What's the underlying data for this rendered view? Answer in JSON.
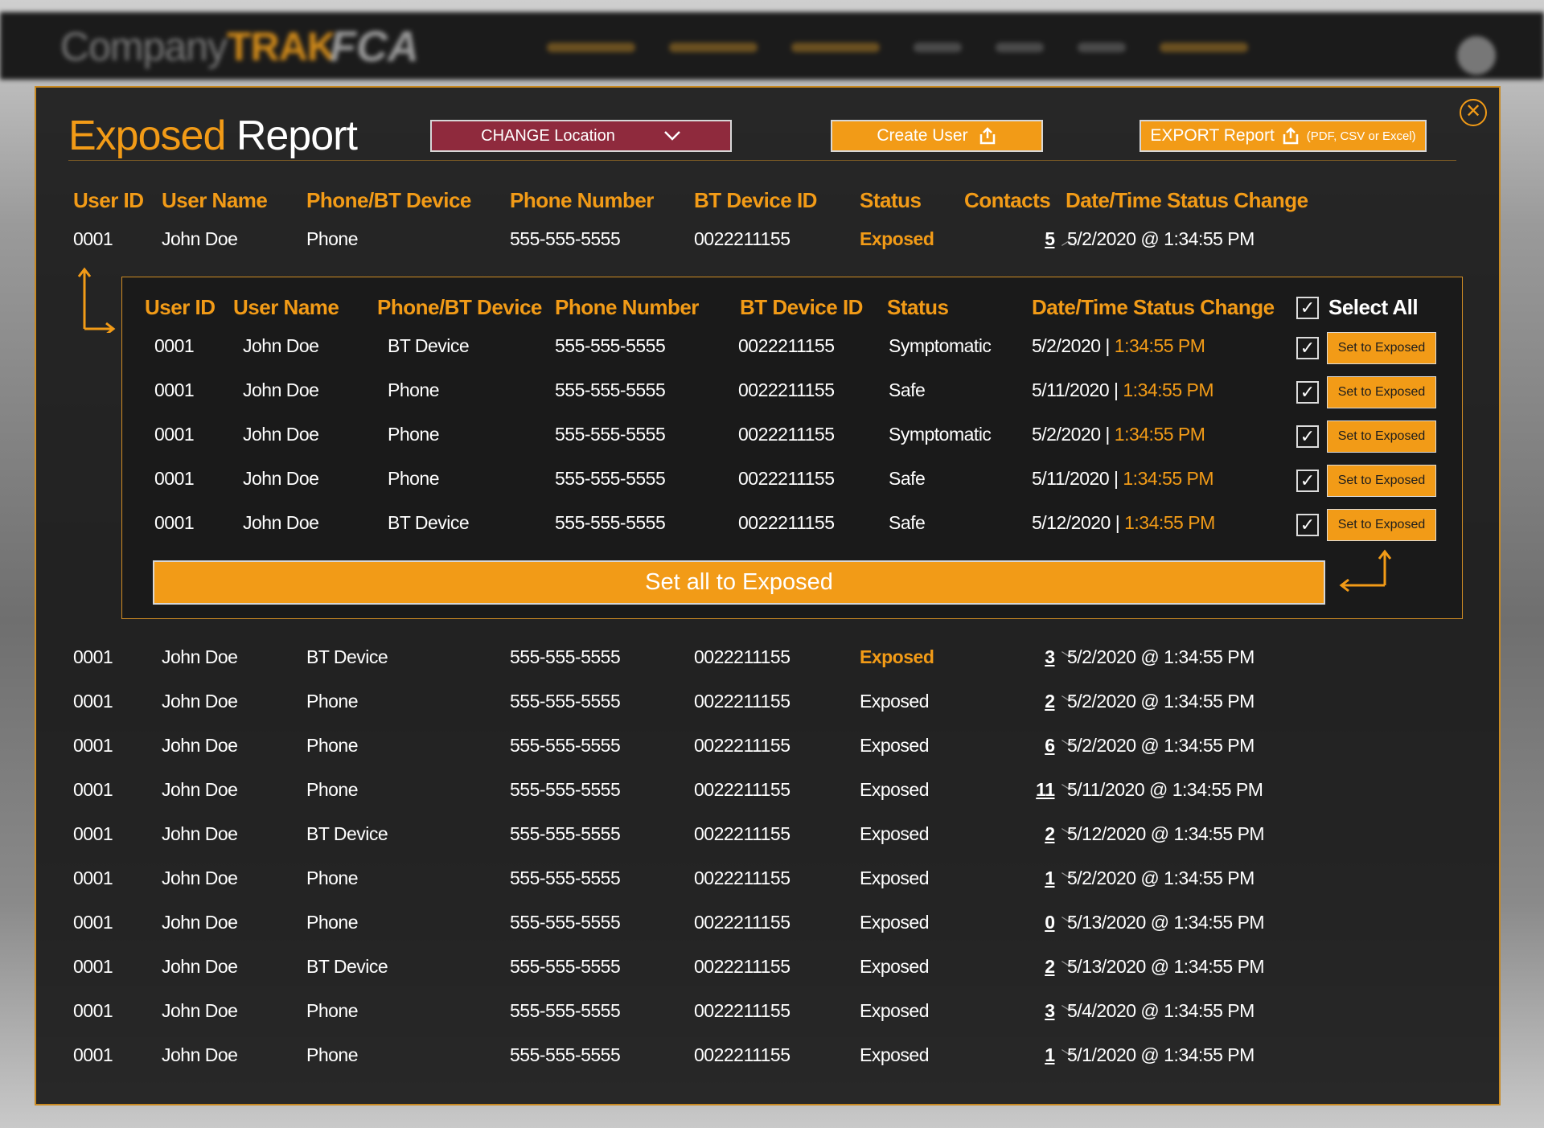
{
  "background": {
    "logo_text": "Company",
    "logo_accent": "TRAK",
    "brand": "FCA"
  },
  "modal": {
    "title_accent": "Exposed",
    "title_rest": "Report",
    "change_location_label": "CHANGE Location",
    "create_user_label": "Create User",
    "export_label": "EXPORT Report",
    "export_formats": "(PDF, CSV or Excel)",
    "close_icon": "close-circle-icon"
  },
  "colors": {
    "accent": "#f29b17",
    "location_button": "#8f2a3d",
    "panel": "#1c1c1c"
  },
  "main_table": {
    "columns": [
      "User ID",
      "User Name",
      "Phone/BT Device",
      "Phone Number",
      "BT Device ID",
      "Status",
      "Contacts",
      "Date/Time Status Change"
    ],
    "rows": [
      {
        "user_id": "0001",
        "user_name": "John Doe",
        "device": "Phone",
        "phone": "555-555-5555",
        "bt_id": "0022211155",
        "status": "Exposed",
        "contacts": "5",
        "changed": "5/2/2020 @ 1:34:55 PM",
        "expanded": true
      },
      {
        "user_id": "0001",
        "user_name": "John Doe",
        "device": "BT Device",
        "phone": "555-555-5555",
        "bt_id": "0022211155",
        "status": "Exposed",
        "contacts": "3",
        "changed": "5/2/2020 @ 1:34:55 PM",
        "expanded": false
      },
      {
        "user_id": "0001",
        "user_name": "John Doe",
        "device": "Phone",
        "phone": "555-555-5555",
        "bt_id": "0022211155",
        "status": "Exposed",
        "contacts": "2",
        "changed": "5/2/2020 @ 1:34:55 PM",
        "expanded": false
      },
      {
        "user_id": "0001",
        "user_name": "John Doe",
        "device": "Phone",
        "phone": "555-555-5555",
        "bt_id": "0022211155",
        "status": "Exposed",
        "contacts": "6",
        "changed": "5/2/2020 @ 1:34:55 PM",
        "expanded": false
      },
      {
        "user_id": "0001",
        "user_name": "John Doe",
        "device": "Phone",
        "phone": "555-555-5555",
        "bt_id": "0022211155",
        "status": "Exposed",
        "contacts": "11",
        "changed": "5/11/2020 @ 1:34:55 PM",
        "expanded": false
      },
      {
        "user_id": "0001",
        "user_name": "John Doe",
        "device": "BT Device",
        "phone": "555-555-5555",
        "bt_id": "0022211155",
        "status": "Exposed",
        "contacts": "2",
        "changed": "5/12/2020 @ 1:34:55 PM",
        "expanded": false
      },
      {
        "user_id": "0001",
        "user_name": "John Doe",
        "device": "Phone",
        "phone": "555-555-5555",
        "bt_id": "0022211155",
        "status": "Exposed",
        "contacts": "1",
        "changed": "5/2/2020 @ 1:34:55 PM",
        "expanded": false
      },
      {
        "user_id": "0001",
        "user_name": "John Doe",
        "device": "Phone",
        "phone": "555-555-5555",
        "bt_id": "0022211155",
        "status": "Exposed",
        "contacts": "0",
        "changed": "5/13/2020 @ 1:34:55 PM",
        "expanded": false
      },
      {
        "user_id": "0001",
        "user_name": "John Doe",
        "device": "BT Device",
        "phone": "555-555-5555",
        "bt_id": "0022211155",
        "status": "Exposed",
        "contacts": "2",
        "changed": "5/13/2020 @ 1:34:55 PM",
        "expanded": false
      },
      {
        "user_id": "0001",
        "user_name": "John Doe",
        "device": "Phone",
        "phone": "555-555-5555",
        "bt_id": "0022211155",
        "status": "Exposed",
        "contacts": "3",
        "changed": "5/4/2020 @ 1:34:55 PM",
        "expanded": false
      },
      {
        "user_id": "0001",
        "user_name": "John Doe",
        "device": "Phone",
        "phone": "555-555-5555",
        "bt_id": "0022211155",
        "status": "Exposed",
        "contacts": "1",
        "changed": "5/1/2020 @ 1:34:55 PM",
        "expanded": false
      }
    ]
  },
  "contacts_table": {
    "columns": [
      "User ID",
      "User Name",
      "Phone/BT Device",
      "Phone Number",
      "BT Device ID",
      "Status",
      "Date/Time Status Change"
    ],
    "select_all_label": "Select All",
    "set_button_label": "Set to Exposed",
    "set_all_label": "Set all to Exposed",
    "rows": [
      {
        "user_id": "0001",
        "user_name": "John Doe",
        "device": "BT Device",
        "phone": "555-555-5555",
        "bt_id": "0022211155",
        "status": "Symptomatic",
        "date": "5/2/2020",
        "time": "1:34:55 PM",
        "checked": true
      },
      {
        "user_id": "0001",
        "user_name": "John Doe",
        "device": "Phone",
        "phone": "555-555-5555",
        "bt_id": "0022211155",
        "status": "Safe",
        "date": "5/11/2020",
        "time": "1:34:55 PM",
        "checked": true
      },
      {
        "user_id": "0001",
        "user_name": "John Doe",
        "device": "Phone",
        "phone": "555-555-5555",
        "bt_id": "0022211155",
        "status": "Symptomatic",
        "date": "5/2/2020",
        "time": "1:34:55 PM",
        "checked": true
      },
      {
        "user_id": "0001",
        "user_name": "John Doe",
        "device": "Phone",
        "phone": "555-555-5555",
        "bt_id": "0022211155",
        "status": "Safe",
        "date": "5/11/2020",
        "time": "1:34:55 PM",
        "checked": true
      },
      {
        "user_id": "0001",
        "user_name": "John Doe",
        "device": "BT Device",
        "phone": "555-555-5555",
        "bt_id": "0022211155",
        "status": "Safe",
        "date": "5/12/2020",
        "time": "1:34:55 PM",
        "checked": true
      }
    ]
  }
}
